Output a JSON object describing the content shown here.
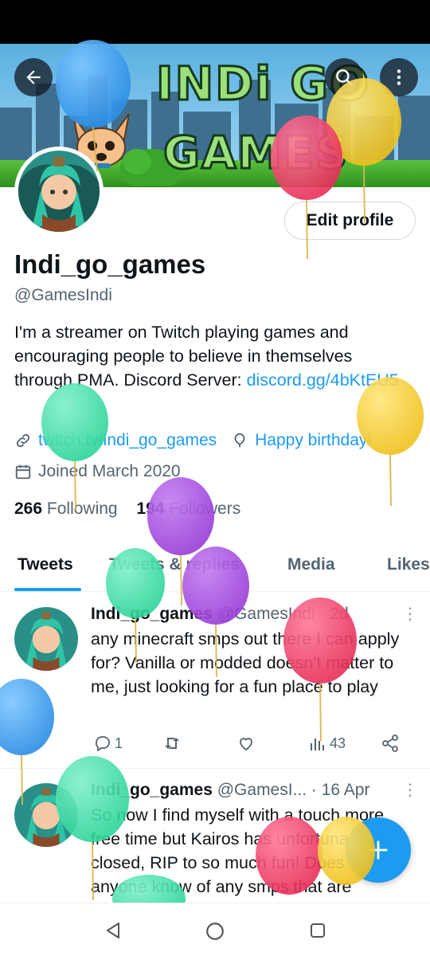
{
  "banner": {
    "title_line1": "INDi GO",
    "title_line2": "GAMES"
  },
  "profile": {
    "edit_label": "Edit profile",
    "name": "Indi_go_games",
    "handle": "@GamesIndi",
    "bio_text": "I'm a streamer on Twitch playing games and encouraging people to believe in themselves through PMA. Discord Server: ",
    "bio_link": "discord.gg/4bKtEU5",
    "website": "twitch.tv/indi_go_games",
    "birthday": "Happy birthday!",
    "joined": "Joined March 2020",
    "following_count": "266",
    "following_label": "Following",
    "followers_count": "194",
    "followers_label": "Followers"
  },
  "tabs": [
    "Tweets",
    "Tweets & replies",
    "Media",
    "Likes"
  ],
  "tweets": [
    {
      "name": "Indi_go_games",
      "handle": "@GamesIndi",
      "time": "· 2d",
      "text": "any minecraft smps out there I can apply for? Vanilla or modded doesn't matter to me, just looking for a fun place to play",
      "replies": "1",
      "retweets": "",
      "likes": "",
      "views": "43"
    },
    {
      "name": "Indi_go_games",
      "handle": "@GamesI...",
      "time": "· 16 Apr",
      "text": "So now I find myself with a touch more free time but Kairos has unfortunately closed, RIP to so much fun! Does anyone know of any smps that are"
    }
  ],
  "icons": {
    "back": "arrow-left-icon",
    "search": "search-icon",
    "more": "more-vertical-icon",
    "link": "link-icon",
    "balloon": "balloon-icon",
    "calendar": "calendar-icon",
    "reply": "reply-icon",
    "retweet": "retweet-icon",
    "like": "heart-icon",
    "views": "views-icon",
    "share": "share-icon",
    "compose": "plus-icon"
  },
  "colors": {
    "accent": "#1d9bf0",
    "text": "#0f1419",
    "secondary": "#536471"
  }
}
